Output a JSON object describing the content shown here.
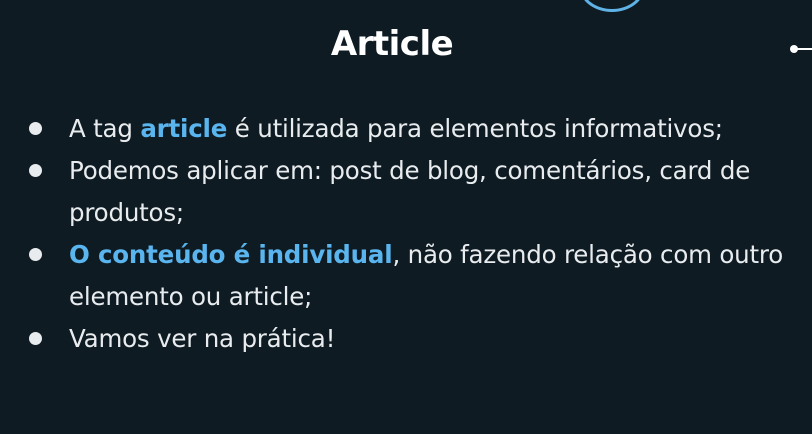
{
  "slide": {
    "title": "Article",
    "bullets": [
      {
        "parts": [
          {
            "text": "A tag ",
            "highlight": false
          },
          {
            "text": "article",
            "highlight": true
          },
          {
            "text": " é utilizada para elementos informativos;",
            "highlight": false
          }
        ]
      },
      {
        "parts": [
          {
            "text": "Podemos aplicar em: post de blog, comentários, card de produtos;",
            "highlight": false
          }
        ]
      },
      {
        "parts": [
          {
            "text": "O conteúdo é individual",
            "highlight": true
          },
          {
            "text": ", não fazendo relação com outro elemento ou article;",
            "highlight": false
          }
        ]
      },
      {
        "parts": [
          {
            "text": "Vamos ver na prática!",
            "highlight": false
          }
        ]
      }
    ]
  },
  "colors": {
    "background": "#0e1b22",
    "text": "#e8ecef",
    "highlight": "#5ab4ee",
    "accent_circle": "#5fb2e6"
  }
}
